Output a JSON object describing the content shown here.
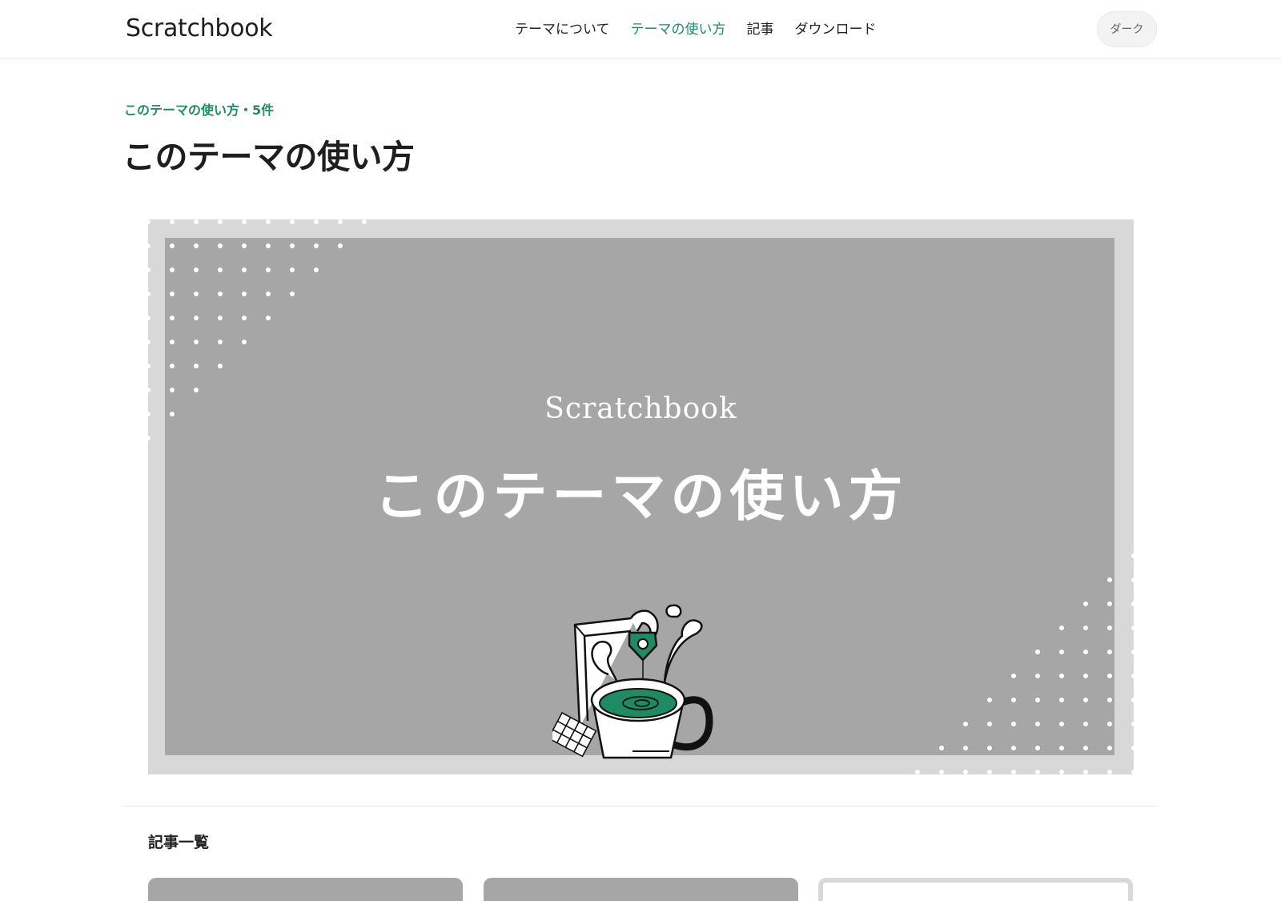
{
  "site": {
    "logo": "Scratchbook"
  },
  "nav": {
    "items": [
      {
        "label": "テーマについて",
        "active": false
      },
      {
        "label": "テーマの使い方",
        "active": true
      },
      {
        "label": "記事",
        "active": false
      },
      {
        "label": "ダウンロード",
        "active": false
      }
    ],
    "theme_toggle": "ダーク"
  },
  "page": {
    "eyebrow": "このテーマの使い方・5件",
    "title": "このテーマの使い方"
  },
  "hero": {
    "brand": "Scratchbook",
    "title": "このテーマの使い方",
    "illustration": "coffee-cup-pen-illustration-icon"
  },
  "list": {
    "section_title": "記事一覧"
  },
  "colors": {
    "accent": "#1f8a63",
    "hero_bg": "#a6a6a6",
    "hero_frame": "#d8d8d8",
    "text": "#222222"
  }
}
